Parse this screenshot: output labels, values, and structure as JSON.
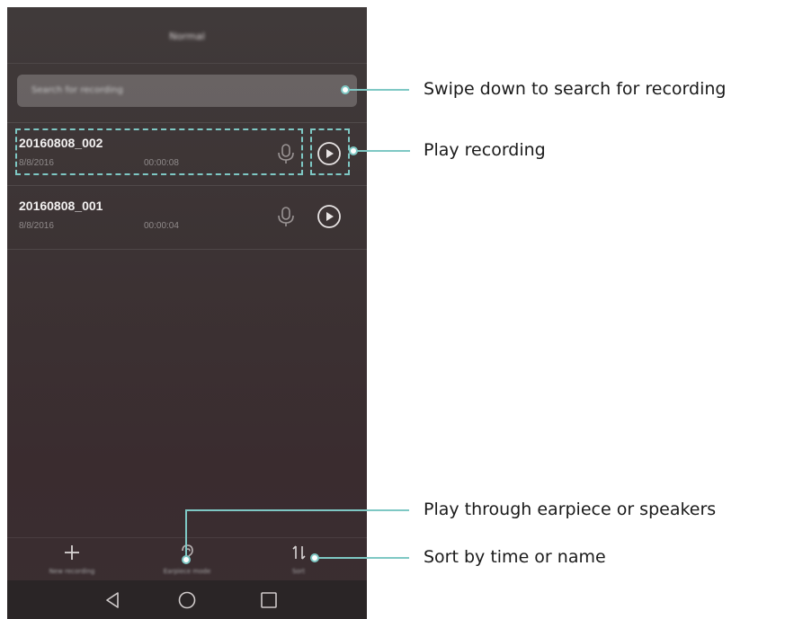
{
  "app": {
    "status_text": "",
    "mode_title": "Normal",
    "search_placeholder": "Search for recording"
  },
  "recordings": [
    {
      "name": "20160808_002",
      "date": "8/8/2016",
      "duration": "00:00:08"
    },
    {
      "name": "20160808_001",
      "date": "8/8/2016",
      "duration": "00:00:04"
    }
  ],
  "bottom_actions": {
    "new_recording": {
      "label": "New recording",
      "icon": "plus-icon"
    },
    "earpiece_mode": {
      "label": "Earpiece mode",
      "icon": "ear-icon"
    },
    "sort": {
      "label": "Sort",
      "icon": "sort-icon"
    }
  },
  "nav": {
    "back": "back-icon",
    "home": "home-icon",
    "recent": "recent-apps-icon"
  },
  "callouts": {
    "search": "Swipe down to search for recording",
    "play": "Play recording",
    "earpiece": "Play through earpiece or speakers",
    "sort": "Sort by time or name"
  },
  "colors": {
    "accent": "#7ec8c4",
    "screen_bg": "#3c3334"
  }
}
